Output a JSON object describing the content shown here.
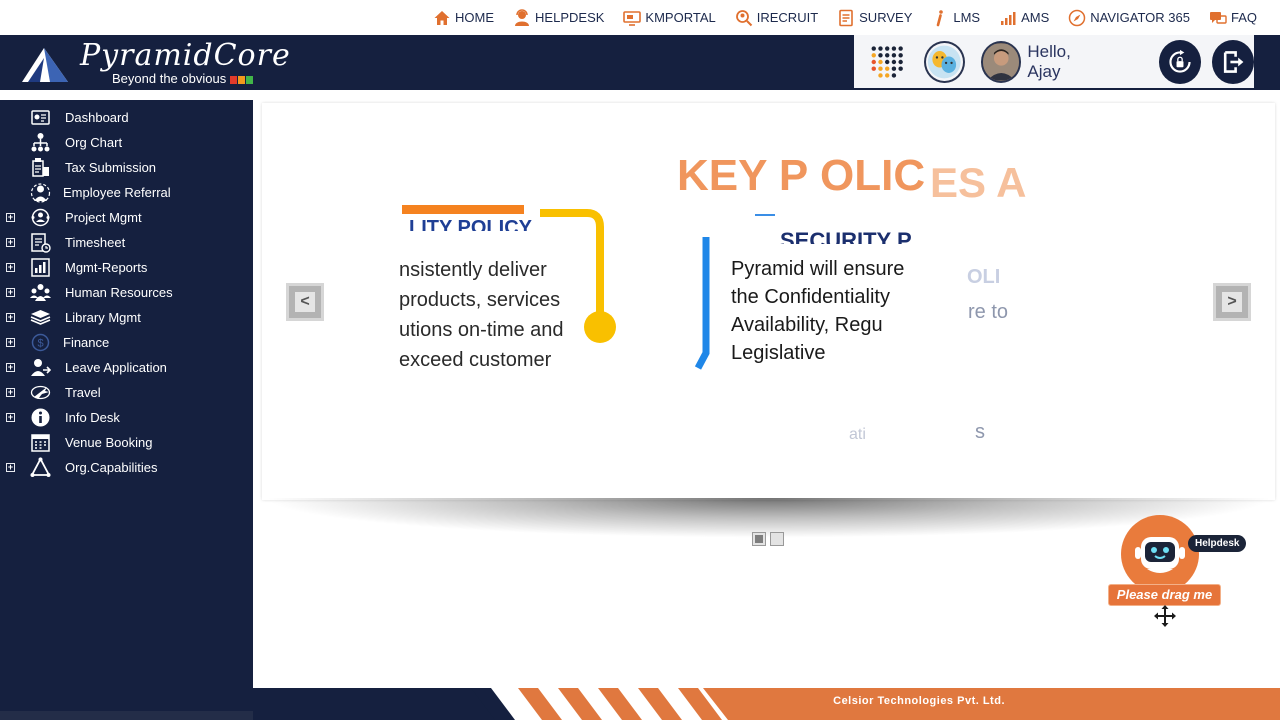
{
  "topnav": {
    "items": [
      {
        "label": "HOME",
        "icon": "home-icon"
      },
      {
        "label": "HELPDESK",
        "icon": "helpdesk-icon"
      },
      {
        "label": "KMPORTAL",
        "icon": "kmportal-icon"
      },
      {
        "label": "IRECRUIT",
        "icon": "irecruit-icon"
      },
      {
        "label": "SURVEY",
        "icon": "survey-icon"
      },
      {
        "label": "LMS",
        "icon": "lms-icon"
      },
      {
        "label": "AMS",
        "icon": "ams-icon"
      },
      {
        "label": "NAVIGATOR 365",
        "icon": "navigator-icon"
      },
      {
        "label": "FAQ",
        "icon": "faq-icon"
      }
    ],
    "icon_color": "#e0702f"
  },
  "header": {
    "brand_name": "PyramidCore",
    "tagline": "Beyond the obvious",
    "greeting": "Hello, Ajay",
    "colors": {
      "bg": "#15203f",
      "accent": "#e97b3c"
    }
  },
  "sidebar": {
    "items": [
      {
        "label": "Dashboard",
        "icon": "dashboard-icon",
        "expandable": false
      },
      {
        "label": "Org Chart",
        "icon": "org-chart-icon",
        "expandable": false
      },
      {
        "label": "Tax Submission",
        "icon": "tax-icon",
        "expandable": false
      },
      {
        "label": "Employee Referral",
        "icon": "referral-icon",
        "expandable": false
      },
      {
        "label": "Project Mgmt",
        "icon": "project-icon",
        "expandable": true
      },
      {
        "label": "Timesheet",
        "icon": "timesheet-icon",
        "expandable": true
      },
      {
        "label": "Mgmt-Reports",
        "icon": "reports-icon",
        "expandable": true
      },
      {
        "label": "Human Resources",
        "icon": "hr-icon",
        "expandable": true
      },
      {
        "label": "Library Mgmt",
        "icon": "library-icon",
        "expandable": true
      },
      {
        "label": "Finance",
        "icon": "finance-icon",
        "expandable": true
      },
      {
        "label": "Leave Application",
        "icon": "leave-icon",
        "expandable": true
      },
      {
        "label": "Travel",
        "icon": "travel-icon",
        "expandable": true
      },
      {
        "label": "Info Desk",
        "icon": "info-icon",
        "expandable": true
      },
      {
        "label": "Venue Booking",
        "icon": "calendar-icon",
        "expandable": false
      },
      {
        "label": "Org.Capabilities",
        "icon": "capabilities-icon",
        "expandable": true
      }
    ]
  },
  "banner": {
    "heading_left": "KEY P",
    "heading_mid": "OLIC",
    "heading_right": "ES A",
    "quality_title": "LITY POLICY",
    "quality_lines": [
      "nsistently deliver",
      "products, services",
      "utions on-time and",
      "exceed customer"
    ],
    "security_title": "SECURITY P",
    "security_lines": [
      "Pyramid will ensure",
      "the Confidentiality",
      "Availability, Regu",
      "Legislative requiremen"
    ],
    "faded_bits": [
      "OLI",
      "re to",
      "ati",
      "s"
    ],
    "prev_label": "<",
    "next_label": ">",
    "slides_count": 2,
    "active_slide": 1
  },
  "bot": {
    "bubble": "Helpdesk",
    "drag_label": "Please drag me"
  },
  "footer": {
    "company": "Celsior Technologies Pvt. Ltd.",
    "stripe_color": "#e0783f"
  }
}
